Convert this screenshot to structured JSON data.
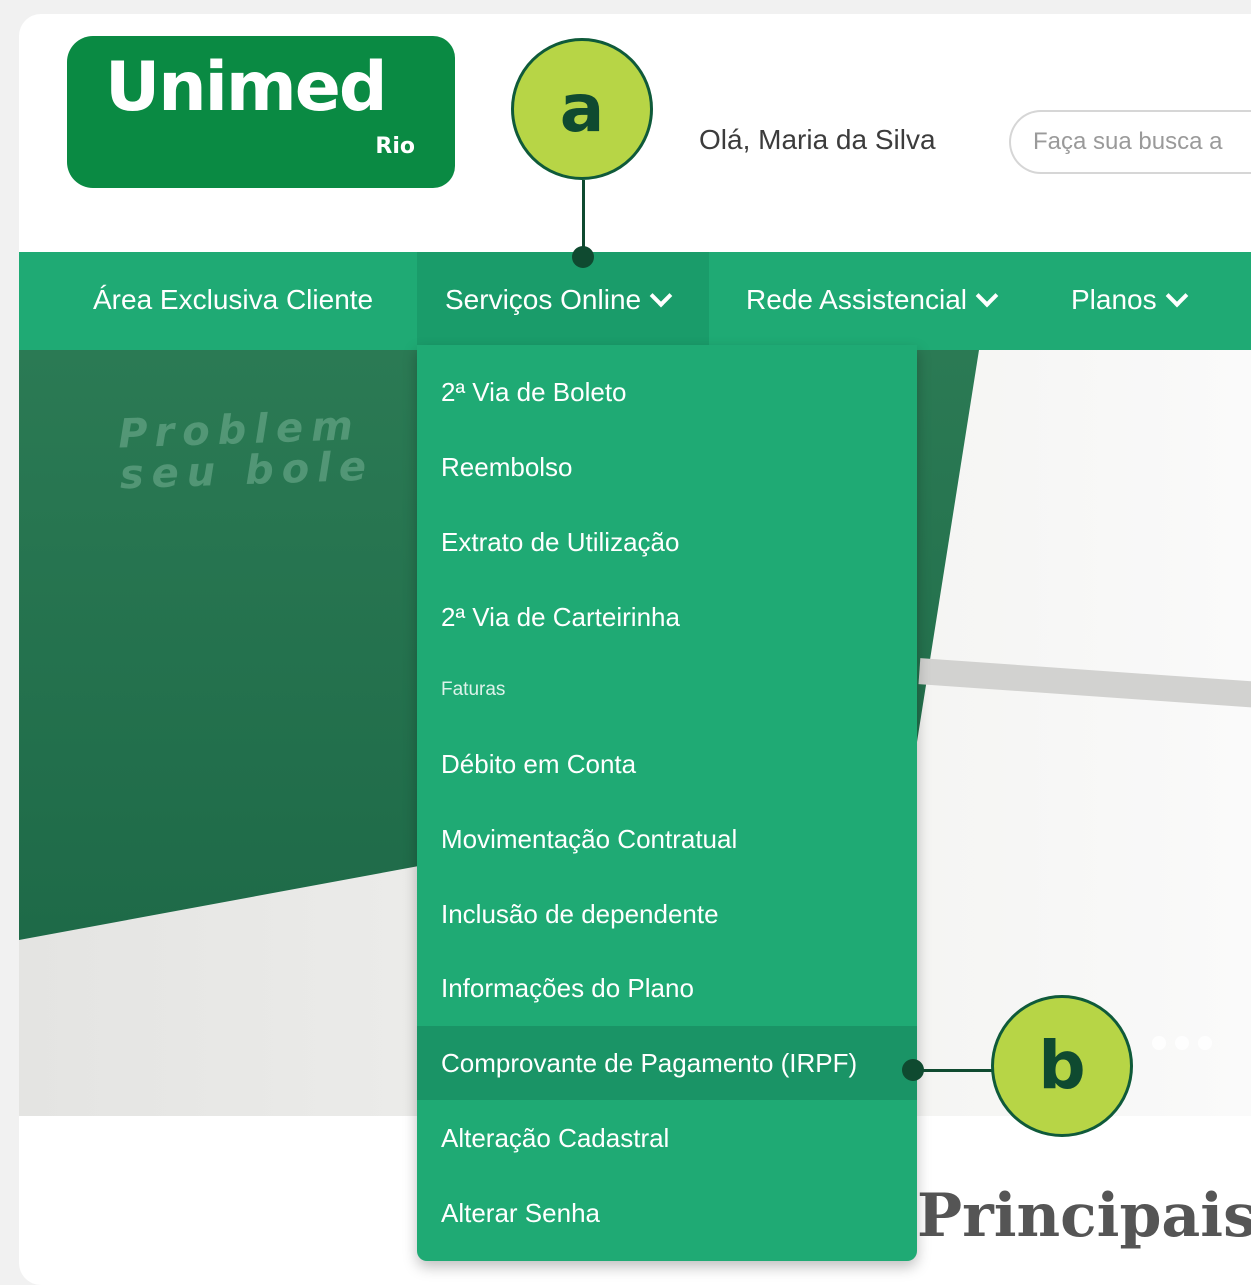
{
  "logo": {
    "name": "Unimed",
    "sub": "Rio"
  },
  "header": {
    "greeting": "Olá, Maria da Silva",
    "search_placeholder": "Faça sua busca a"
  },
  "nav": [
    {
      "label": "Área Exclusiva Cliente",
      "has_dropdown": false
    },
    {
      "label": "Serviços Online",
      "has_dropdown": true,
      "active": true
    },
    {
      "label": "Rede Assistencial",
      "has_dropdown": true
    },
    {
      "label": "Planos",
      "has_dropdown": true
    }
  ],
  "dropdown": {
    "items": [
      "2ª Via de Boleto",
      "Reembolso",
      "Extrato de Utilização",
      "2ª Via de Carteirinha",
      "Faturas",
      "Débito em Conta",
      "Movimentação Contratual",
      "Inclusão de dependente",
      "Informações do Plano",
      "Comprovante de Pagamento (IRPF)",
      "Alteração Cadastral",
      "Alterar Senha"
    ],
    "highlighted_index": 9
  },
  "banner": {
    "text_line1": "Problem",
    "text_line2": "seu bole"
  },
  "section_heading": "Principais",
  "callouts": {
    "a": "a",
    "b": "b"
  },
  "colors": {
    "brand_green": "#0a8a43",
    "nav_green": "#1faa74",
    "callout_fill": "#b7d546",
    "callout_dark": "#0f4a30"
  }
}
